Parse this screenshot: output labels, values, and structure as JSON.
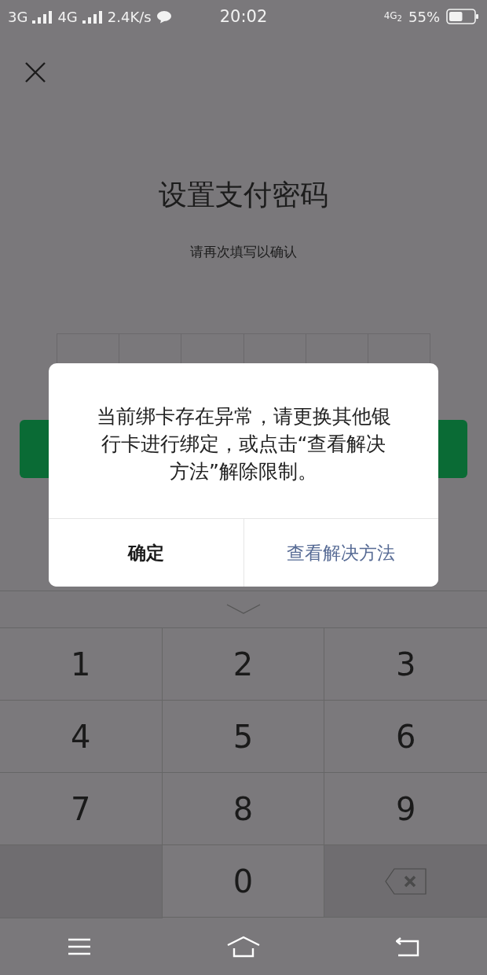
{
  "status_bar": {
    "network_1": "3G",
    "network_2": "4G",
    "speed": "2.4K/s",
    "time": "20:02",
    "network_3": "4G$_{2}$",
    "battery": {
      "label": "55%",
      "level": 0.55
    }
  },
  "title": "设置支付密码",
  "subtitle": "请再次填写以确认",
  "dialog": {
    "message": "当前绑卡存在异常，请更换其他银行卡进行绑定，或点击“查看解决方法”解除限制。",
    "buttons": [
      {
        "label": "确定",
        "kind": "default"
      },
      {
        "label": "查看解决方法",
        "kind": "link"
      }
    ]
  },
  "keypad": [
    {
      "kind": "digit",
      "label": "1"
    },
    {
      "kind": "digit",
      "label": "2"
    },
    {
      "kind": "digit",
      "label": "3"
    },
    {
      "kind": "digit",
      "label": "4"
    },
    {
      "kind": "digit",
      "label": "5"
    },
    {
      "kind": "digit",
      "label": "6"
    },
    {
      "kind": "digit",
      "label": "7"
    },
    {
      "kind": "digit",
      "label": "8"
    },
    {
      "kind": "digit",
      "label": "9"
    },
    {
      "kind": "blank"
    },
    {
      "kind": "digit",
      "label": "0"
    },
    {
      "kind": "delete"
    }
  ]
}
